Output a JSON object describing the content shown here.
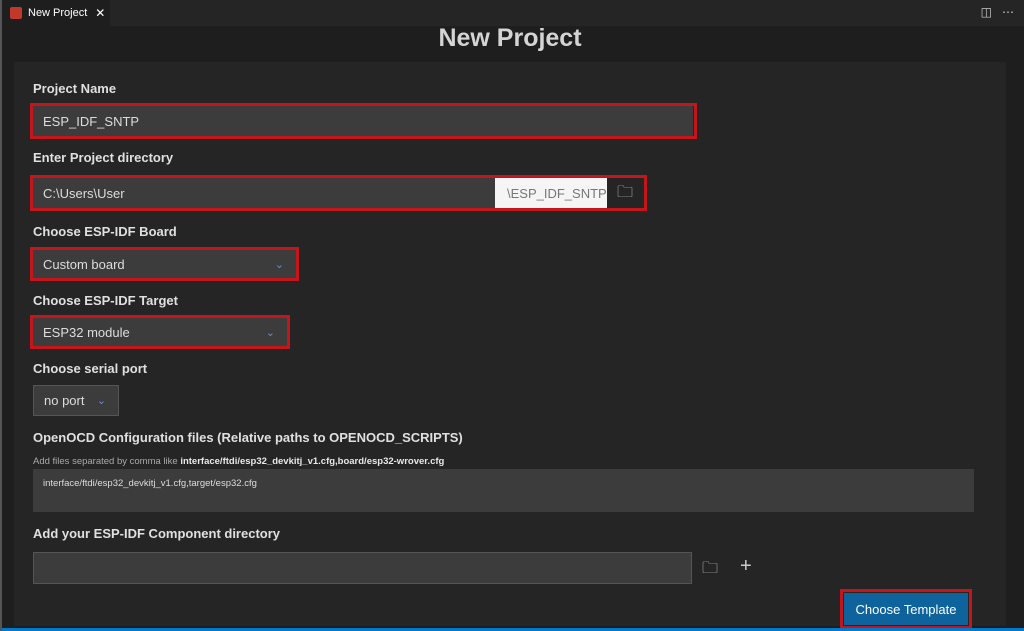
{
  "tab": {
    "title": "New Project",
    "close": "✕"
  },
  "page_title": "New Project",
  "project_name": {
    "label": "Project Name",
    "value": "ESP_IDF_SNTP"
  },
  "directory": {
    "label": "Enter Project directory",
    "value": "C:\\Users\\User",
    "suffix": "\\ESP_IDF_SNTP"
  },
  "board": {
    "label": "Choose ESP-IDF Board",
    "value": "Custom board"
  },
  "target": {
    "label": "Choose ESP-IDF Target",
    "value": "ESP32 module"
  },
  "serial": {
    "label": "Choose serial port",
    "value": "no port"
  },
  "openocd": {
    "label": "OpenOCD Configuration files (Relative paths to OPENOCD_SCRIPTS)",
    "hint": "Add files separated by comma like ",
    "hint_example": "interface/ftdi/esp32_devkitj_v1.cfg,board/esp32-wrover.cfg",
    "value": "interface/ftdi/esp32_devkitj_v1.cfg,target/esp32.cfg"
  },
  "component": {
    "label": "Add your ESP-IDF Component directory",
    "value": ""
  },
  "choose_template": "Choose Template",
  "chev": "⌄"
}
